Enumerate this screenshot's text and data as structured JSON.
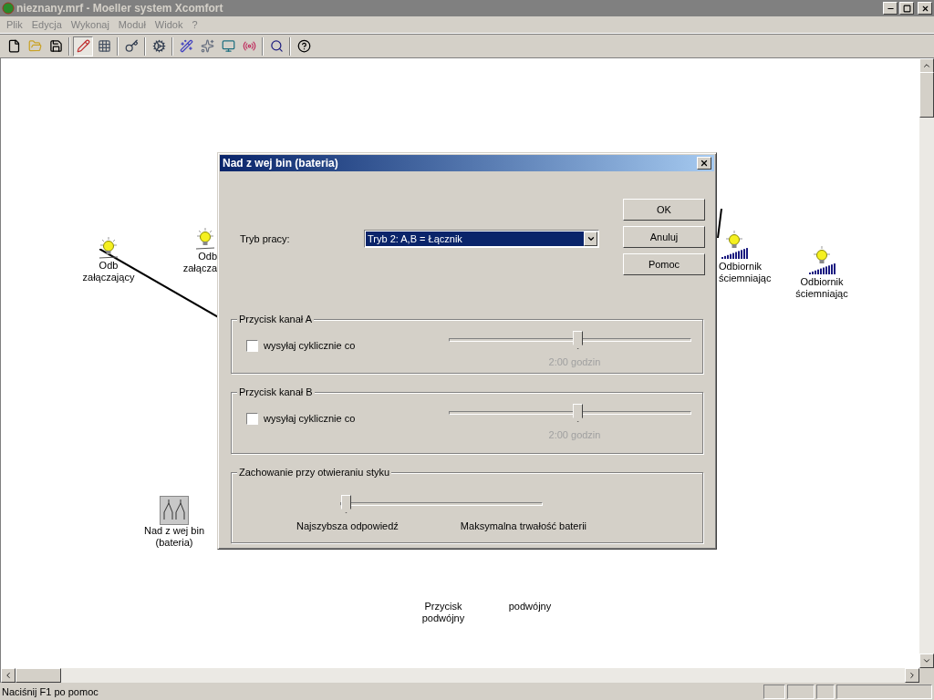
{
  "window": {
    "title": "nieznany.mrf - Moeller system Xcomfort",
    "active": false
  },
  "menu": [
    "Plik",
    "Edycja",
    "Wykonaj",
    "Moduł",
    "Widok",
    "?"
  ],
  "toolbar": [
    {
      "pressed": false
    },
    {
      "pressed": false
    },
    {
      "pressed": false
    },
    {
      "pressed": true
    },
    {
      "pressed": false
    },
    {
      "pressed": false
    },
    {
      "pressed": false
    },
    {
      "pressed": false
    },
    {
      "pressed": false
    },
    {
      "pressed": false
    },
    {
      "pressed": false
    },
    {
      "pressed": false
    },
    {
      "pressed": false
    }
  ],
  "canvas": {
    "nodes": [
      {
        "kind": "bulb",
        "label": [
          "Odb",
          "załączający"
        ]
      },
      {
        "kind": "bulb",
        "label": [
          "Odb",
          "załącza"
        ]
      },
      {
        "kind": "dimmer",
        "label": [
          "Odbiornik",
          "ściemniając"
        ]
      },
      {
        "kind": "dimmer",
        "label": [
          "Odbiornik",
          "ściemniając"
        ]
      },
      {
        "kind": "switch",
        "label": [
          "Nad z wej bin",
          "(bateria)"
        ]
      },
      {
        "kind": "text",
        "label": [
          "Przycisk",
          "podwójny"
        ]
      },
      {
        "kind": "text",
        "label": [
          "podwójny"
        ]
      }
    ]
  },
  "dialog": {
    "title": "Nad z wej bin (bateria)",
    "mode_label": "Tryb pracy:",
    "mode_value": "Tryb 2: A,B = Łącznik",
    "buttons": [
      "OK",
      "Anuluj",
      "Pomoc"
    ],
    "channels": [
      {
        "title": "Przycisk kanał A",
        "checkbox_label": "wysyłaj cyklicznie co",
        "checked": false,
        "level": 0.53,
        "reading": "2:00 godzin",
        "reading_disabled": true
      },
      {
        "title": "Przycisk kanał B",
        "checkbox_label": "wysyłaj cyklicznie co",
        "checked": false,
        "level": 0.53,
        "reading": "2:00 godzin",
        "reading_disabled": true
      }
    ],
    "contact": {
      "title": "Zachowanie przy otwieraniu styku",
      "level": 0,
      "min_label": "Najszybsza odpowiedź",
      "max_label": "Maksymalna trwałość baterii"
    }
  },
  "status_bar": "Naciśnij F1 po pomoc"
}
